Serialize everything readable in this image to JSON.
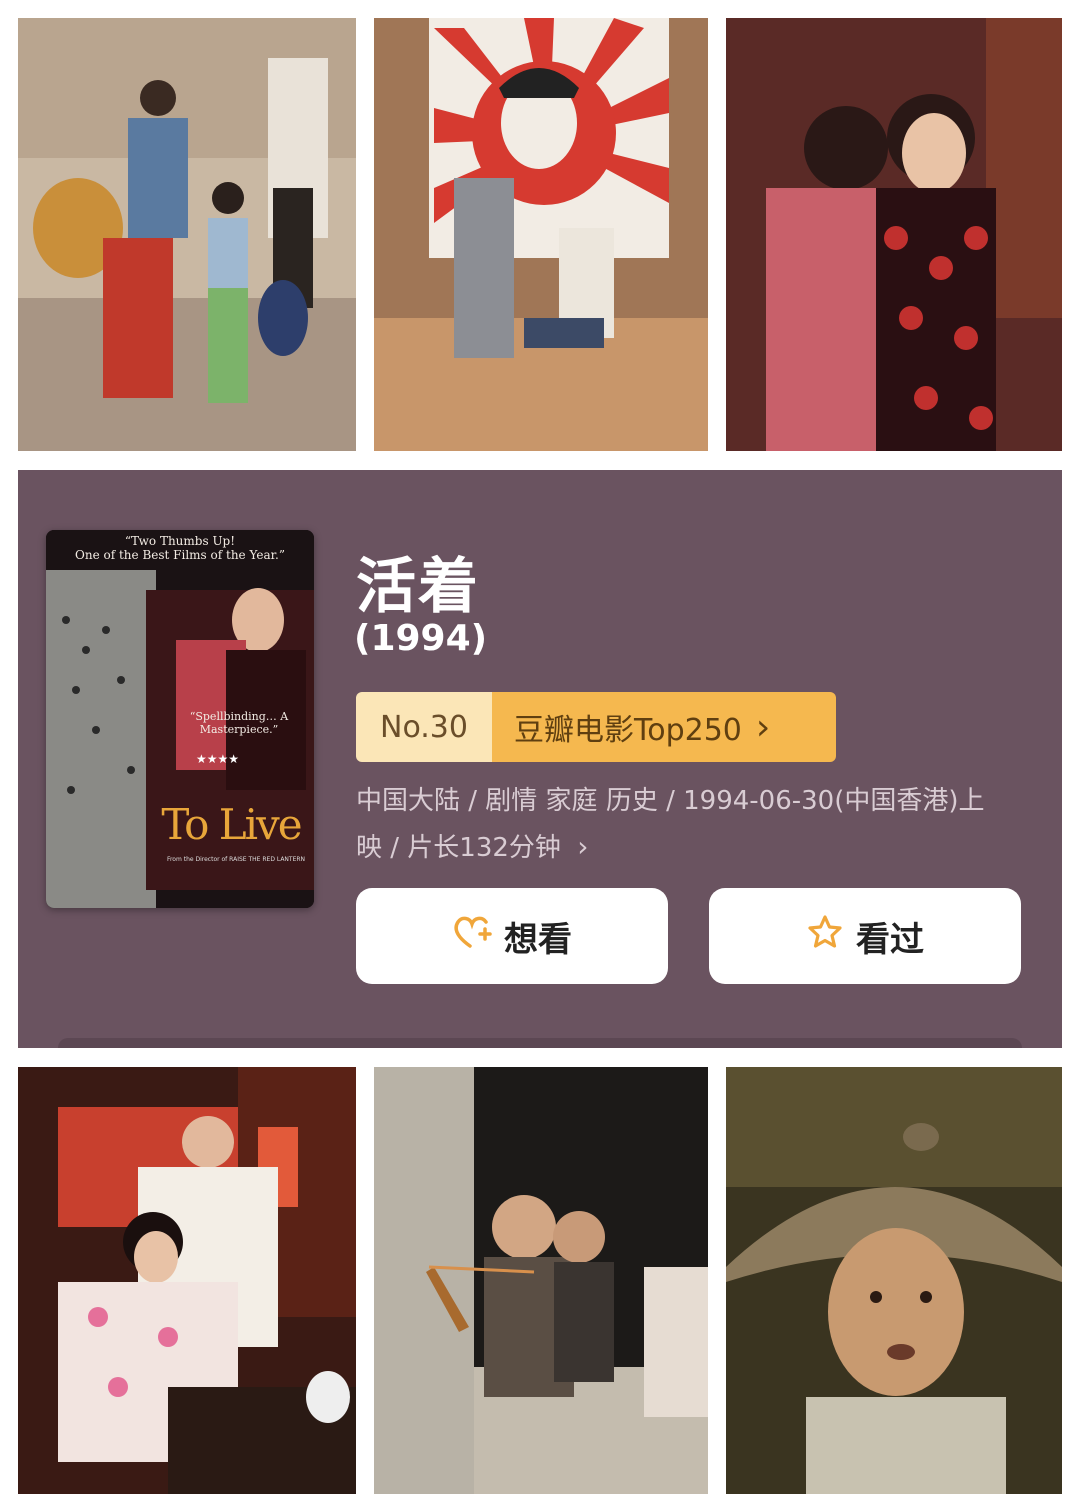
{
  "movie": {
    "title": "活着",
    "year": "(1994)",
    "rank_no": "No.30",
    "rank_list": "豆瓣电影Top250",
    "meta": "中国大陆 / 剧情 家庭 历史 / 1994-06-30(中国香港)上映 / 片长132分钟",
    "chevron": "›"
  },
  "poster": {
    "quote_top_1": "“Two Thumbs Up!",
    "quote_top_2": "One of the Best Films of the Year.”",
    "quote_mid": "“Spellbinding… A Masterpiece.”",
    "stars": "★★★★",
    "title": "To Live",
    "credit": "From the Director of RAISE THE RED LANTERN"
  },
  "actions": {
    "want_label": "想看",
    "seen_label": "看过",
    "accent": "#f0a63a"
  }
}
